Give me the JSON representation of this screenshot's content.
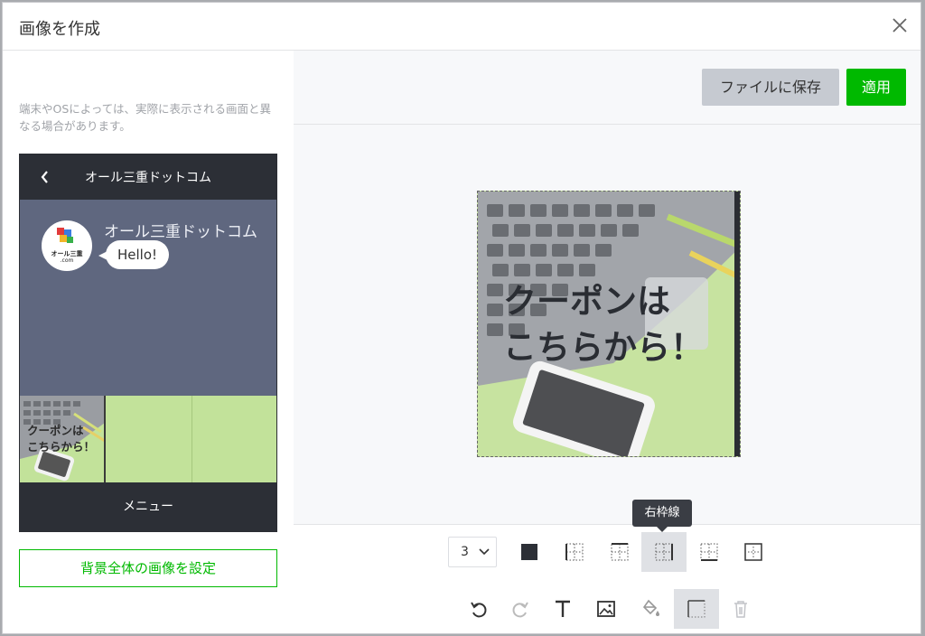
{
  "dialog": {
    "title": "画像を作成"
  },
  "preview": {
    "note": "端末やOSによっては、実際に表示される画面と異なる場合があります。",
    "account_name": "オール三重ドットコム",
    "avatar_text": "オール三重",
    "avatar_sub": ".com",
    "message": "Hello!",
    "rich_text": "クーポンは\nこちらから！",
    "menu_label": "メニュー",
    "bg_button": "背景全体の画像を設定"
  },
  "toolbar": {
    "save_label": "ファイルに保存",
    "apply_label": "適用"
  },
  "canvas": {
    "text": "クーポンは\nこちらから！"
  },
  "border_tools": {
    "width_value": "3",
    "tooltip": "右枠線",
    "active": "right-border"
  },
  "icons": [
    "close-icon",
    "back-chevron-icon",
    "border-color-icon",
    "left-border-icon",
    "top-border-icon",
    "right-border-icon",
    "bottom-border-icon",
    "inner-border-icon",
    "undo-icon",
    "redo-icon",
    "text-icon",
    "image-icon",
    "fill-icon",
    "border-icon",
    "trash-icon"
  ],
  "colors": {
    "accent": "#00b900",
    "dark": "#2c2f36",
    "chat_bg": "#5f677f"
  }
}
